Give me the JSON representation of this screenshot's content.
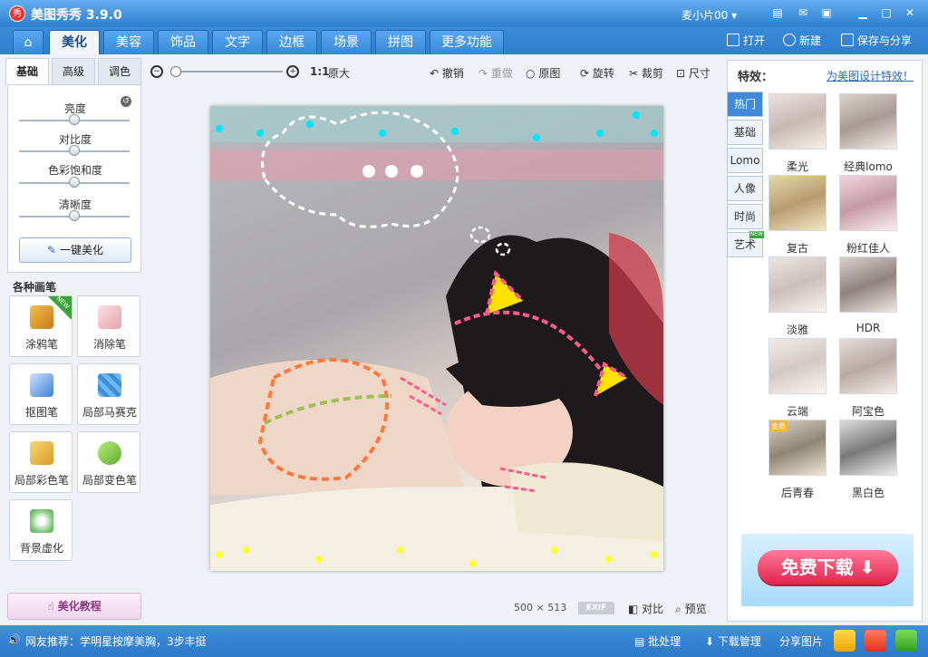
{
  "app": {
    "title": "美图秀秀 3.9.0",
    "logo": "秀",
    "user": "麦小片00"
  },
  "tabs": [
    {
      "label": "美化",
      "active": true
    },
    {
      "label": "美容"
    },
    {
      "label": "饰品"
    },
    {
      "label": "文字"
    },
    {
      "label": "边框"
    },
    {
      "label": "场景"
    },
    {
      "label": "拼图"
    },
    {
      "label": "更多功能"
    }
  ],
  "top_actions": {
    "open": "打开",
    "new": "新建",
    "save": "保存与分享"
  },
  "subtabs": [
    "基础",
    "高级",
    "调色"
  ],
  "adjust": {
    "brightness": "亮度",
    "contrast": "对比度",
    "saturation": "色彩饱和度",
    "sharpness": "清晰度",
    "brightness_value": 0.5,
    "contrast_value": 0.5,
    "saturation_value": 0.5,
    "sharpness_value": 0.5,
    "oneclick": "一键美化"
  },
  "brushes": {
    "title": "各种画笔",
    "items": [
      "涂鸦笔",
      "消除笔",
      "抠图笔",
      "局部马赛克",
      "局部彩色笔",
      "局部变色笔",
      "背景虚化"
    ],
    "new_badge": "NEW"
  },
  "tutorial": "美化教程",
  "toolbar": {
    "ratio": "1:1",
    "original_size": "原大",
    "undo": "撤销",
    "redo": "重做",
    "original": "原图",
    "rotate": "旋转",
    "crop": "裁剪",
    "resize": "尺寸"
  },
  "image_info": {
    "width": "500",
    "x": "×",
    "height": "513",
    "exif": "EXIF",
    "compare": "对比",
    "preview": "预览"
  },
  "effects": {
    "title": "特效：",
    "link": "为美图设计特效！",
    "categories": [
      "热门",
      "基础",
      "Lomo",
      "人像",
      "时尚",
      "艺术"
    ],
    "category_badge": "NEW",
    "items": [
      "柔光",
      "经典lomo",
      "复古",
      "粉红佳人",
      "淡雅",
      "HDR",
      "云端",
      "阿宝色",
      "后青春",
      "黑白色"
    ],
    "gold_badge": "金质"
  },
  "ad": {
    "button": "免费下载"
  },
  "status": {
    "recommend": "网友推荐：学明星按摩美胸，3步丰挺",
    "batch": "批处理",
    "download": "下载管理",
    "share": "分享图片"
  }
}
